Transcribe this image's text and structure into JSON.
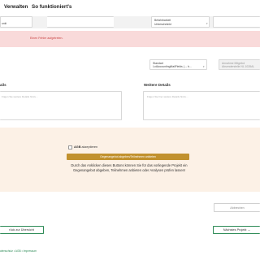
{
  "nav": {
    "item_manage": "Verwalten",
    "item_how": "So funktioniert's"
  },
  "top_fields": {
    "left_value": "unkt",
    "right_label": "Befahrbarkeit",
    "right_value": "Unbeschränkt"
  },
  "error": {
    "message": "Einen Fehler aufgetreten."
  },
  "standard_field": {
    "label": "Standart",
    "value": "LotAccountingMailFields (→ b..."
  },
  "status_field": {
    "label": "Annahme Mitgebot",
    "value": "Absenderstelle NL 1028AL"
  },
  "details": {
    "left_label": "ails",
    "left_placeholder": "Fügen Sie weitere Details hinzu...",
    "right_label": "Weitere Details",
    "right_placeholder": "Fügen Sie hier weitere Details hinzu..."
  },
  "offer": {
    "checkbox_label_bold": "AGB",
    "checkbox_label_rest": "akzeptieren",
    "button_label": "Gegenangebot abgeben/Teilnehmen anbieten",
    "description": "Durch das Anklicken dieses Buttons können Sie für das vorliegende Projekt ein Gegenangebot abgeben, Teilnehmen anbieten oder Analysen prüfen lassen!"
  },
  "actions": {
    "cancel_label": "Abbrechen",
    "back_label": "rück zur Übersicht",
    "next_label": "Nächstes Projekt →"
  },
  "footer": {
    "link_privacy": "atenschutz",
    "sep1": " • ",
    "link_agb": "AGB",
    "sep2": " • ",
    "link_imprint": "Impressum"
  }
}
